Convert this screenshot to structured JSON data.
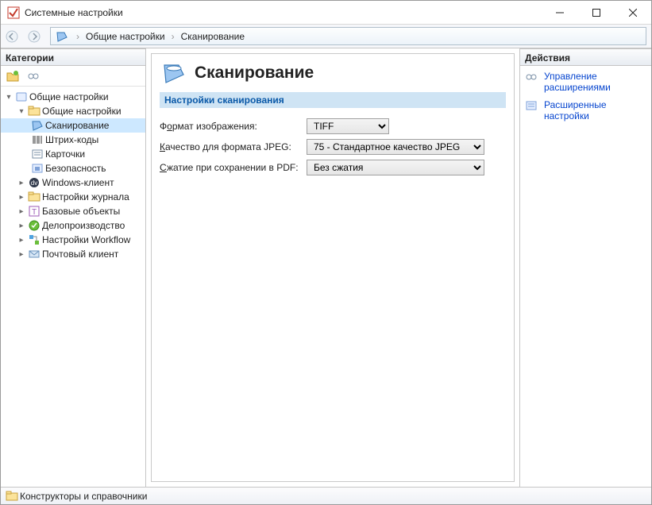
{
  "window": {
    "title": "Системные настройки"
  },
  "breadcrumb": {
    "item1": "Общие настройки",
    "item2": "Сканирование"
  },
  "categories": {
    "title": "Категории",
    "root": "Общие настройки",
    "children": [
      "Сканирование",
      "Штрих-коды",
      "Карточки",
      "Безопасность"
    ],
    "siblings": [
      "Windows-клиент",
      "Настройки журнала",
      "Базовые объекты",
      "Делопроизводство",
      "Настройки Workflow",
      "Почтовый клиент"
    ]
  },
  "page": {
    "title": "Сканирование",
    "section": "Настройки сканирования",
    "fields": {
      "imgfmt_label_pre": "Ф",
      "imgfmt_label_u": "о",
      "imgfmt_label_post": "рмат изображения:",
      "quality_label_pre": "",
      "quality_label_u": "К",
      "quality_label_post": "ачество для формата JPEG:",
      "compress_label_pre": "",
      "compress_label_u": "С",
      "compress_label_post": "жатие при сохранении в PDF:",
      "imgfmt_value": "TIFF",
      "quality_value": "75 - Стандартное качество JPEG",
      "compress_value": "Без сжатия"
    }
  },
  "actions": {
    "title": "Действия",
    "items": [
      {
        "line1": "Управление",
        "line2": "расширениями"
      },
      {
        "line1": "Расширенные",
        "line2": "настройки"
      }
    ]
  },
  "status": "Конструкторы и справочники"
}
